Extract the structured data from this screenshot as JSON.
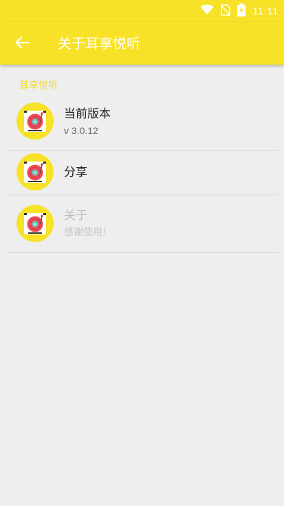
{
  "status_bar": {
    "time": "11:11",
    "icons": [
      "wifi-icon",
      "no-sim-icon",
      "battery-charging-icon"
    ]
  },
  "toolbar": {
    "back_icon": "arrow-back-icon",
    "title": "关于耳享悦听"
  },
  "section": {
    "title": "耳享悦听"
  },
  "items": [
    {
      "title": "当前版本",
      "subtitle": "v 3.0.12",
      "icon": "turntable-icon"
    },
    {
      "title": "分享",
      "icon": "turntable-icon"
    },
    {
      "title": "关于",
      "subtitle": "感谢使用！",
      "icon": "turntable-icon",
      "disabled": true
    }
  ],
  "colors": {
    "accent": "#f7e228",
    "background": "#eeeeee",
    "icon_red": "#ef4a57"
  }
}
